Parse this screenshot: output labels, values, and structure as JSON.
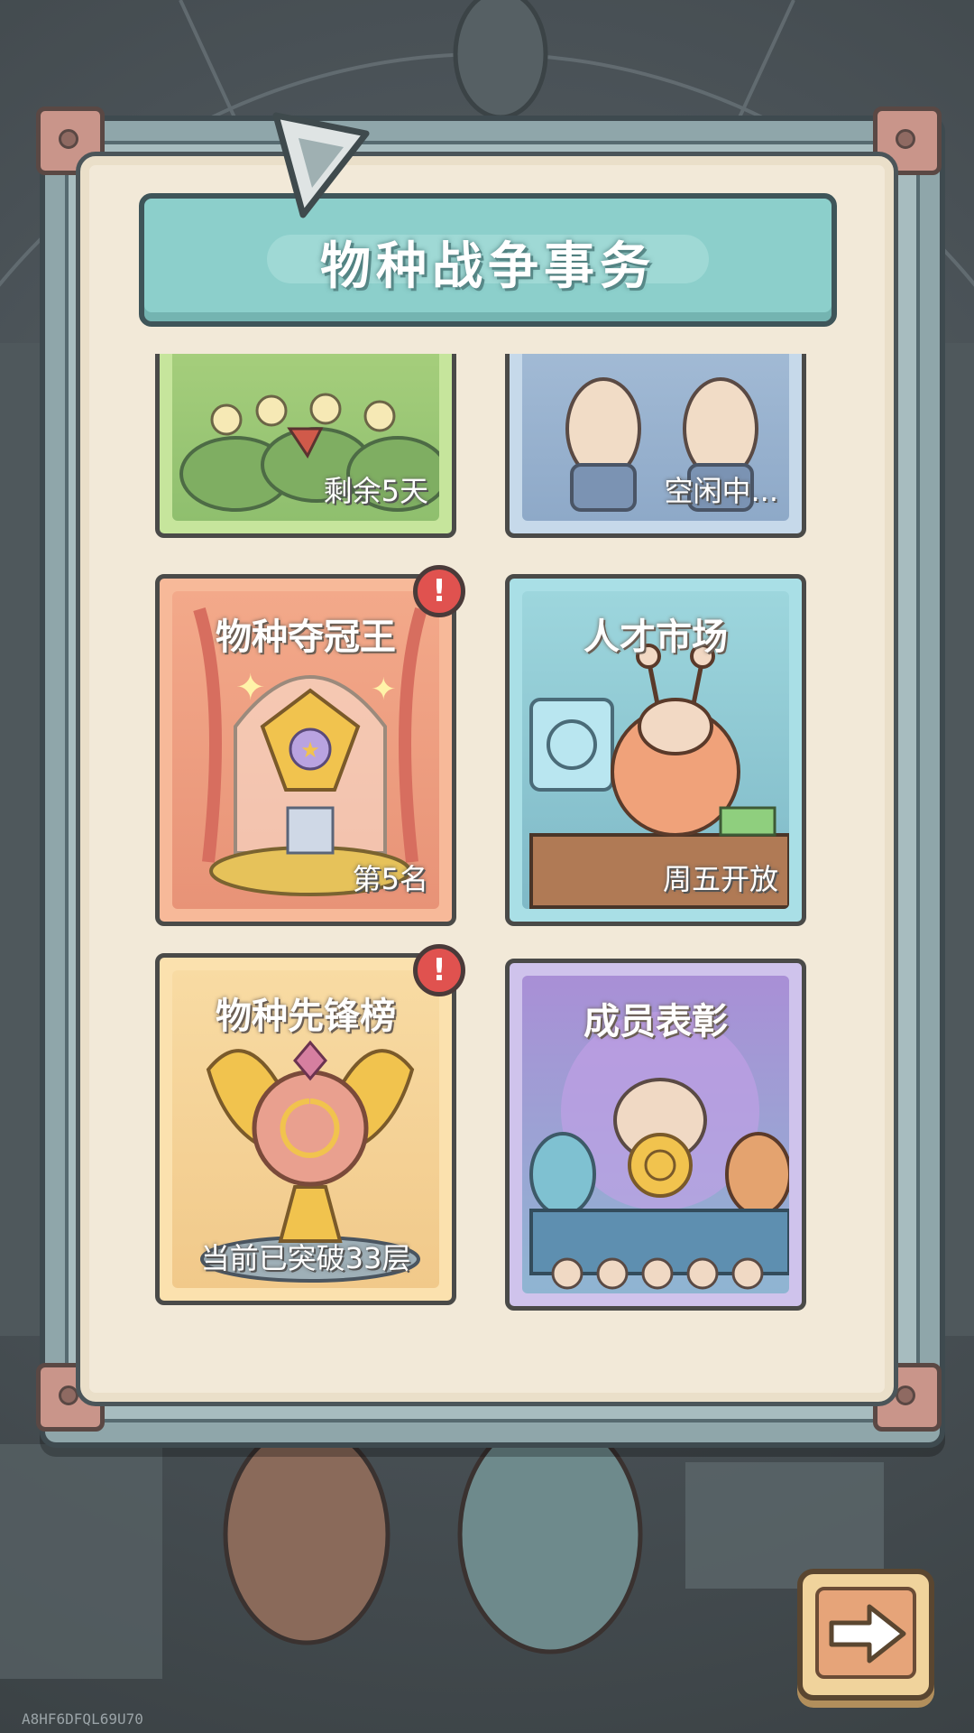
{
  "header": {
    "title": "物种战争事务"
  },
  "cards": [
    {
      "id": "species-battle",
      "title": "",
      "status": "剩余5天",
      "theme": "#a9d17c",
      "badge": false
    },
    {
      "id": "idle-mission",
      "title": "",
      "status": "空闲中...",
      "theme": "#a7c6e4",
      "badge": false
    },
    {
      "id": "species-champion",
      "title": "物种夺冠王",
      "status": "第5名",
      "theme": "#f0a07c",
      "badge": true
    },
    {
      "id": "talent-market",
      "title": "人才市场",
      "status": "周五开放",
      "theme": "#8fd0d8",
      "badge": false
    },
    {
      "id": "species-vanguard",
      "title": "物种先锋榜",
      "status": "当前已突破33层",
      "theme": "#f4cf86",
      "badge": true
    },
    {
      "id": "member-commendation",
      "title": "成员表彰",
      "status": "",
      "theme": "#b9a4de",
      "badge": false
    }
  ],
  "badge_glyph": "!",
  "next_button": {
    "icon": "arrow-right-icon"
  },
  "watermark": "A8HF6DFQL69U70"
}
